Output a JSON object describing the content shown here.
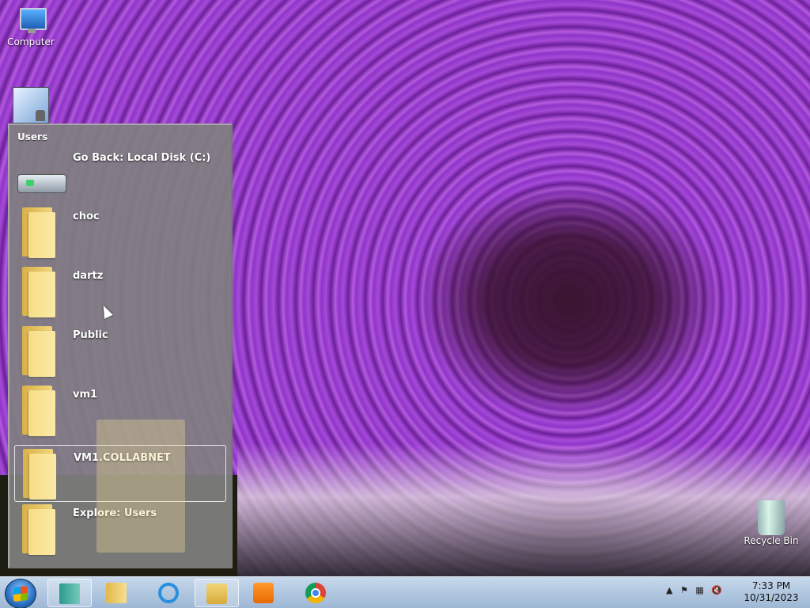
{
  "desktop": {
    "icons": [
      {
        "label": "Computer",
        "icon": "computer-icon"
      },
      {
        "label": "",
        "icon": "network-lock-icon"
      },
      {
        "label": "Recycle Bin",
        "icon": "recycle-bin-icon"
      }
    ]
  },
  "jumplist": {
    "title": "Users",
    "items": [
      {
        "label": "Go Back: Local Disk (C:)",
        "icon": "drive-icon"
      },
      {
        "label": "choc",
        "icon": "folder-icon"
      },
      {
        "label": "dartz",
        "icon": "folder-icon"
      },
      {
        "label": "Public",
        "icon": "folder-icon"
      },
      {
        "label": "vm1",
        "icon": "folder-icon"
      },
      {
        "label": "VM1.COLLABNET",
        "icon": "folder-icon",
        "selected": true
      },
      {
        "label": "Explore: Users",
        "icon": "folder-icon"
      }
    ]
  },
  "taskbar": {
    "start": "start-orb-icon",
    "buttons": [
      {
        "name": "app-button",
        "icon": "door-icon"
      },
      {
        "name": "folder-button",
        "icon": "folder-icon"
      },
      {
        "name": "internet-explorer-button",
        "icon": "ie-icon"
      },
      {
        "name": "windows-explorer-button",
        "icon": "explorer-icon"
      },
      {
        "name": "media-player-button",
        "icon": "media-icon"
      },
      {
        "name": "chrome-button",
        "icon": "chrome-icon"
      }
    ],
    "tray": {
      "show_hidden": "▲",
      "flag": "⚑",
      "network": "▦",
      "volume": "🔇"
    },
    "clock": {
      "time": "7:33 PM",
      "date": "10/31/2023"
    }
  }
}
